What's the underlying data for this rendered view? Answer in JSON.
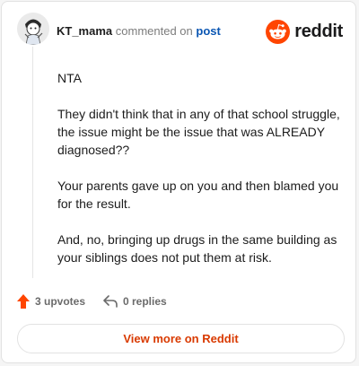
{
  "comment": {
    "username": "KT_mama",
    "commented_on_text": "commented on",
    "post_link": "post",
    "paragraphs": [
      "NTA",
      "They didn't think that in any of that school struggle, the issue might be the issue that was ALREADY diagnosed??",
      "Your parents gave up on you and then blamed you for the result.",
      "And, no, bringing up drugs in the same building as your siblings does not put them at risk."
    ],
    "upvotes": "3 upvotes",
    "replies": "0 replies"
  },
  "brand": {
    "name": "reddit",
    "icon": "reddit-logo-icon",
    "color": "#ff4500"
  },
  "footer": {
    "view_more": "View more on Reddit"
  },
  "colors": {
    "accent": "#d93a00",
    "link": "#0a56b3",
    "upvote": "#ff4500"
  }
}
